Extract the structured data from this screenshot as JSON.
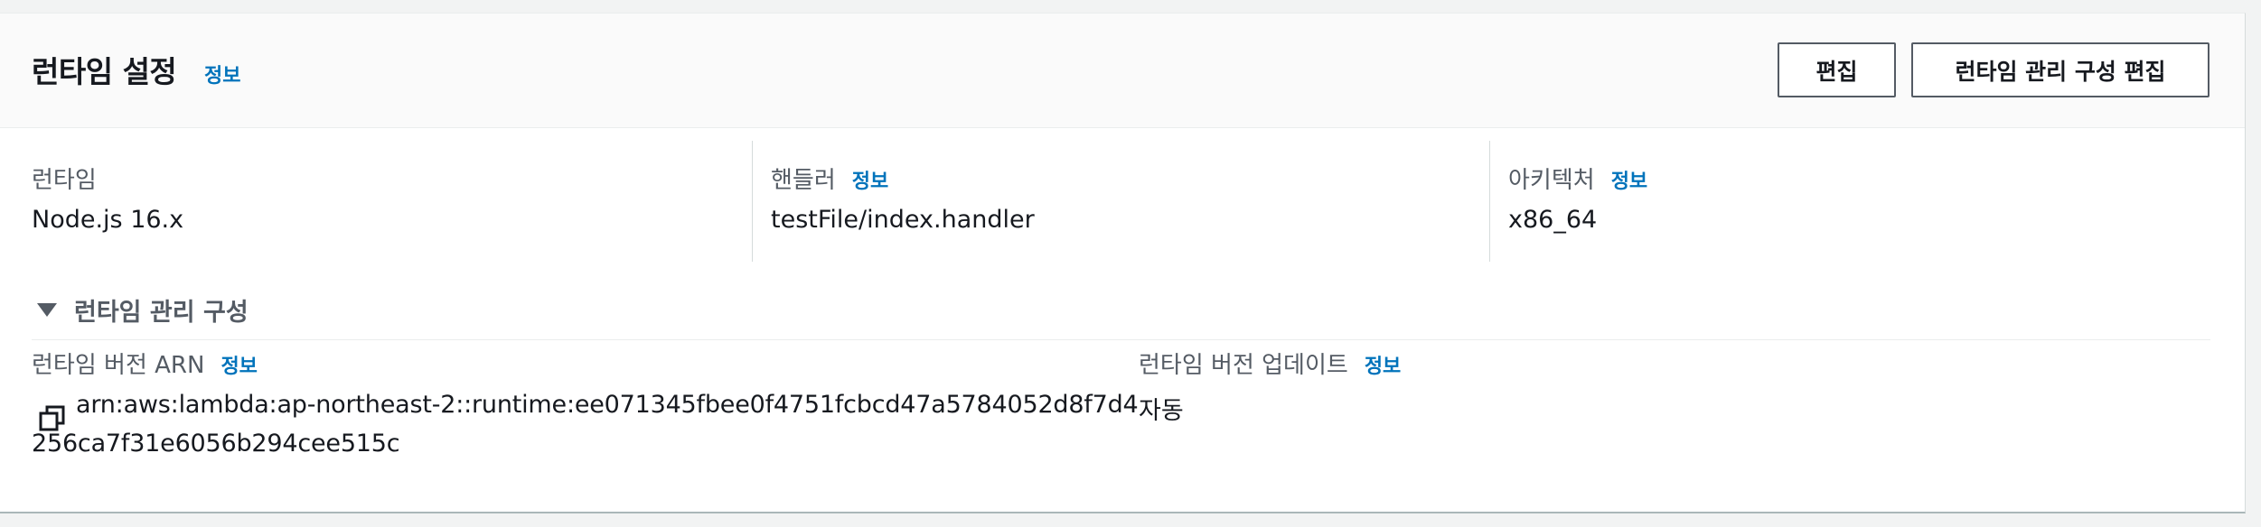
{
  "section": {
    "title": "런타임 설정",
    "info": "정보",
    "buttons": {
      "edit": "편집",
      "edit_runtime_management": "런타임 관리 구성 편집"
    }
  },
  "fields": {
    "runtime": {
      "label": "런타임",
      "value": "Node.js 16.x"
    },
    "handler": {
      "label": "핸들러",
      "info": "정보",
      "value": "testFile/index.handler"
    },
    "architecture": {
      "label": "아키텍처",
      "info": "정보",
      "value": "x86_64"
    }
  },
  "runtime_management": {
    "title": "런타임 관리 구성",
    "expanded": true,
    "version_arn": {
      "label": "런타임 버전 ARN",
      "info": "정보",
      "value_line1": "arn:aws:lambda:ap-northeast-2::runtime:ee071345fbee0f4751fcbcd47a5784052d8f7d4",
      "value_line2": "256ca7f31e6056b294cee515c",
      "copy_icon": "copy-icon"
    },
    "version_update": {
      "label": "런타임 버전 업데이트",
      "info": "정보",
      "value": "자동"
    }
  },
  "colors": {
    "link": "#0073bb",
    "text": "#16191f",
    "label": "#545b64",
    "header_bg": "#fafafa",
    "page_bg": "#f2f3f3"
  }
}
